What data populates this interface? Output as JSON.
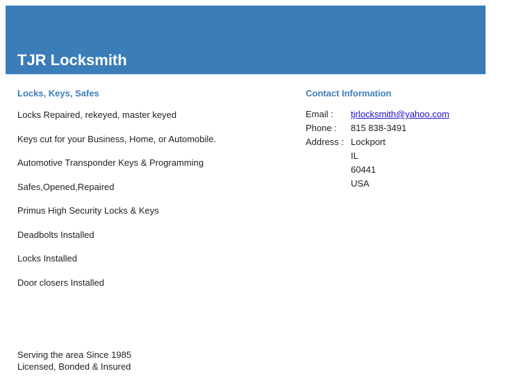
{
  "header": {
    "title": "TJR Locksmith"
  },
  "services": {
    "heading": "Locks, Keys, Safes",
    "items": [
      "Locks Repaired, rekeyed, master keyed",
      "Keys cut for your Business, Home, or Automobile.",
      "Automotive Transponder Keys & Programming",
      "Safes,Opened,Repaired",
      "Primus High Security Locks & Keys",
      "Deadbolts Installed",
      "Locks Installed",
      "Door closers Installed"
    ]
  },
  "contact": {
    "heading": "Contact Information",
    "email_label": "Email :",
    "email": "tjrlocksmith@yahoo.com",
    "phone_label": "Phone :",
    "phone": "815 838-3491",
    "address_label": "Address :",
    "address": [
      "Lockport",
      "IL",
      "60441",
      "USA"
    ]
  },
  "footer": {
    "line1": "Serving the area Since 1985",
    "line2": "Licensed, Bonded & Insured"
  }
}
